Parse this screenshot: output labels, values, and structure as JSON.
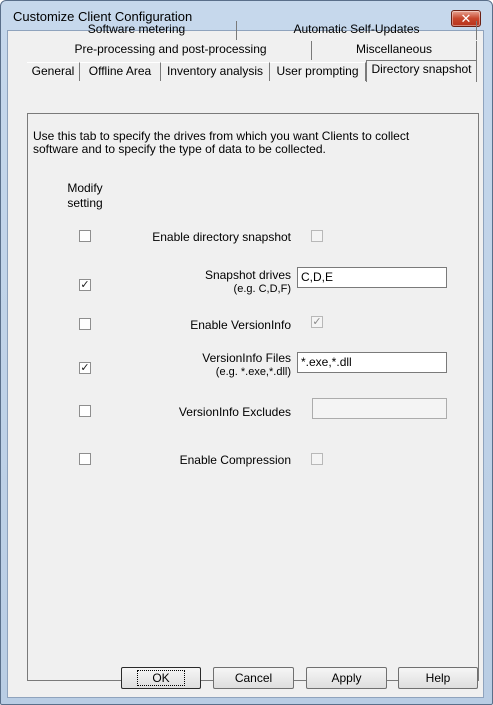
{
  "window": {
    "title": "Customize Client Configuration",
    "close_label": "✕"
  },
  "tabs": {
    "row1": [
      "Software metering",
      "Automatic Self-Updates"
    ],
    "row2": [
      "Pre-processing and post-processing",
      "Miscellaneous"
    ],
    "row3": [
      "General",
      "Offline Area",
      "Inventory analysis",
      "User prompting",
      "Directory snapshot"
    ],
    "selected": "Directory snapshot"
  },
  "panel": {
    "description": "Use this tab to specify the drives from which you want Clients to collect software and to specify the type of data to be collected.",
    "modify_header": "Modify setting",
    "settings": [
      {
        "label": "Enable directory snapshot",
        "modify_checked": false,
        "value_checked": false,
        "value_enabled": false
      },
      {
        "label": "Snapshot drives",
        "sublabel": "(e.g. C,D,F)",
        "modify_checked": true,
        "value": "C,D,E"
      },
      {
        "label": "Enable VersionInfo",
        "modify_checked": false,
        "value_checked": true,
        "value_enabled": false
      },
      {
        "label": "VersionInfo Files",
        "sublabel": "(e.g. *.exe,*.dll)",
        "modify_checked": true,
        "value": "*.exe,*.dll"
      },
      {
        "label": "VersionInfo Excludes",
        "modify_checked": false,
        "value": ""
      },
      {
        "label": "Enable Compression",
        "modify_checked": false,
        "value_checked": false,
        "value_enabled": false
      }
    ]
  },
  "buttons": {
    "ok": "OK",
    "cancel": "Cancel",
    "apply": "Apply",
    "help": "Help"
  }
}
